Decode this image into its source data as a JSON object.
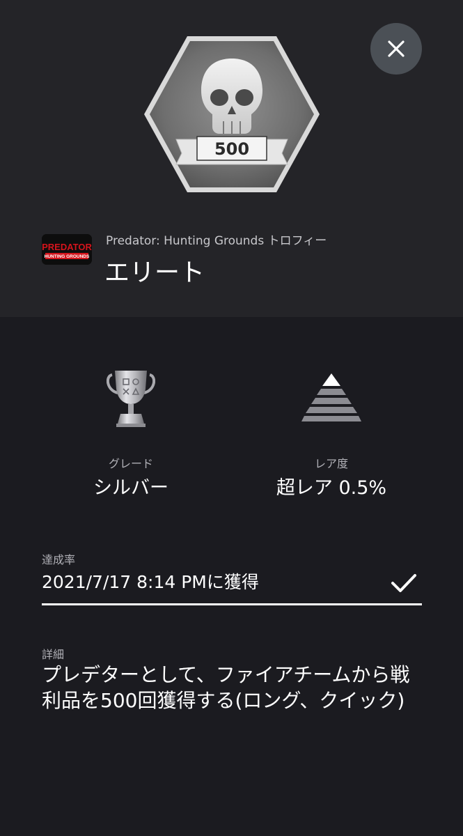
{
  "trophy_art": {
    "badge_number": "500"
  },
  "game": {
    "icon_line1": "PREDATOR",
    "icon_line2": "HUNTING GROUNDS",
    "title": "Predator: Hunting Grounds トロフィー"
  },
  "trophy": {
    "name": "エリート"
  },
  "stats": {
    "grade_label": "グレード",
    "grade_value": "シルバー",
    "rarity_label": "レア度",
    "rarity_value": "超レア 0.5%"
  },
  "achievement": {
    "label": "達成率",
    "earned_text": "2021/7/17  8:14 PMに獲得"
  },
  "details": {
    "label": "詳細",
    "description": "プレデターとして、ファイアチームから戦利品を500回獲得する(ロング、クイック)"
  },
  "colors": {
    "background": "#1b1b20",
    "top_panel": "#242428",
    "close_button": "#4b5056",
    "silver": "#a9a9ae"
  },
  "icons": {
    "close": "close-icon",
    "trophy_art": "skull-icon",
    "grade": "silver-trophy-icon",
    "rarity": "pyramid-icon",
    "check": "check-icon"
  }
}
